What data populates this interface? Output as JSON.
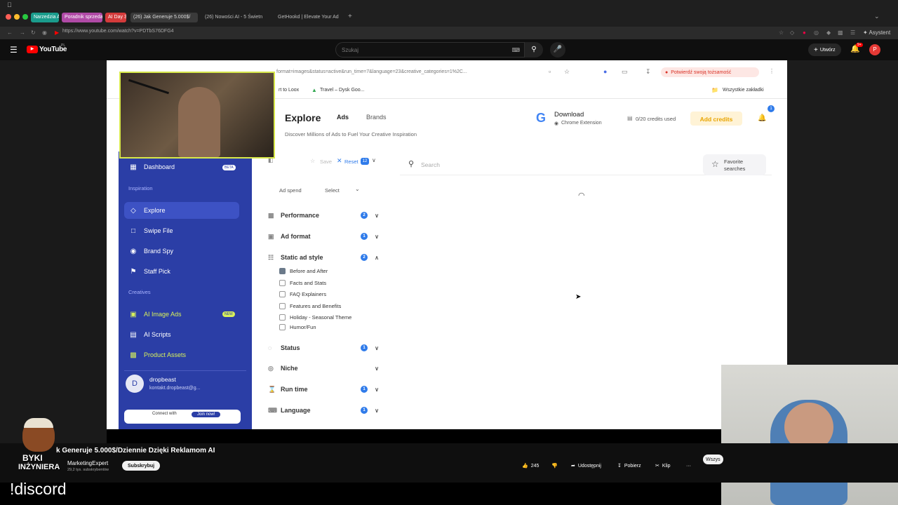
{
  "browser": {
    "tabs": [
      "Narzedzia AI",
      "Poradnik sprzedaz",
      "AI Day 3",
      "(26) Jak Generuje 5.000$/",
      "(26) Nowości AI - 5 Świetn",
      "GetHookd | Elevate Your Ad"
    ],
    "url": "https://www.youtube.com/watch?v=PDTbS76DFG4",
    "new_tab": "+"
  },
  "youtube": {
    "logo": "YouTube",
    "logo_sup": "PL",
    "search_placeholder": "Szukaj",
    "create_label": "Utwórz",
    "notif_count": "9+",
    "avatar_letter": "P"
  },
  "inner_browser": {
    "url_fragment": "format=images&status=active&run_time=7&language=23&creative_categories=1%2C...",
    "verify_label": "Potwierdź swoją tożsamość",
    "bookmark_1": "rt to Loox",
    "bookmark_2": "Travel – Dysk Goo...",
    "bookmark_all": "Wszystkie zakładki"
  },
  "app": {
    "title": "Explore",
    "tab_ads": "Ads",
    "tab_brands": "Brands",
    "subtitle": "Discover Millions of Ads to Fuel Your Creative Inspiration",
    "download_label": "Download",
    "chrome_ext": "Chrome Extension",
    "credits": "0/20 credits used",
    "add_credits": "Add credits",
    "notif_dot": "1",
    "search_placeholder": "Search",
    "favorite": "Favorite searches",
    "sidebar": {
      "dashboard": "Dashboard",
      "dashboard_badge": "BETA",
      "section_inspiration": "Inspiration",
      "explore": "Explore",
      "swipe": "Swipe File",
      "brandspy": "Brand Spy",
      "staffpick": "Staff Pick",
      "section_creatives": "Creatives",
      "aiimage": "AI Image Ads",
      "aiimage_badge": "NEW",
      "aiscripts": "AI Scripts",
      "productassets": "Product Assets",
      "user_name": "dropbeast",
      "user_email": "kontakt.dropbeast@g...",
      "user_initial": "D",
      "connect": "Connect with",
      "join": "Join now!"
    },
    "filters": {
      "save": "Save",
      "reset": "Reset",
      "reset_count": "12",
      "ad_spend": "Ad spend",
      "select": "Select",
      "performance": "Performance",
      "performance_count": "2",
      "ad_format": "Ad format",
      "ad_format_count": "1",
      "static_style": "Static ad style",
      "static_style_count": "2",
      "opt1": "Before and After",
      "opt2": "Facts and Stats",
      "opt3": "FAQ Explainers",
      "opt4": "Features and Benefits",
      "opt5": "Holiday - Seasonal Theme",
      "opt6": "Humor/Fun",
      "status": "Status",
      "status_count": "1",
      "niche": "Niche",
      "run_time": "Run time",
      "run_time_count": "1",
      "language": "Language",
      "language_count": "1"
    }
  },
  "video": {
    "title": "k Generuje 5.000$/Dziennie Dzięki Reklamom AI",
    "channel": "MarketingExpert",
    "subs": "29,2 tys. subskrybentów",
    "subscribe": "Subskrybuj",
    "likes": "245",
    "share": "Udostępnij",
    "download": "Pobierz",
    "clip": "Klip",
    "more": "···",
    "all": "Wszys",
    "channel_logo_line1": "BYKI",
    "channel_logo_line2": "INŻYNIERA"
  },
  "overlay": {
    "discord": "!discord"
  },
  "colors": {
    "sidebar": "#2b3ea6",
    "accent": "#2f7bea",
    "yt_red": "#ff0000"
  }
}
